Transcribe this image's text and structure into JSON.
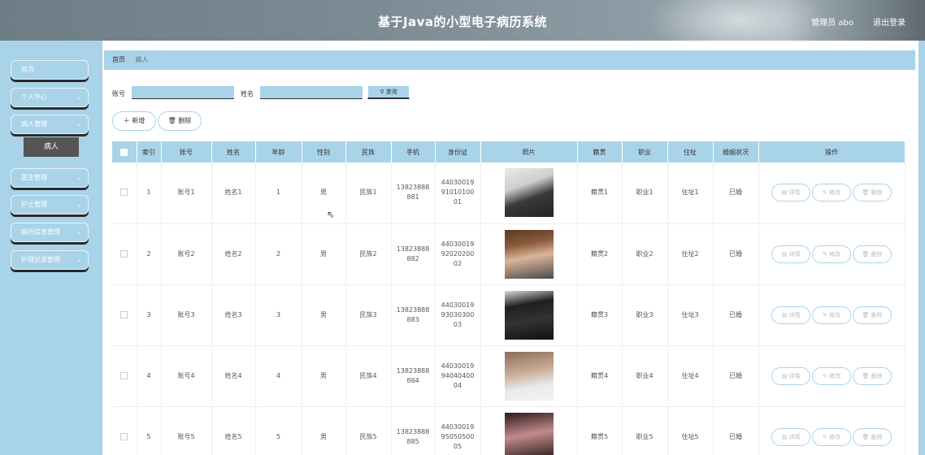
{
  "header": {
    "title": "基于Java的小型电子病历系统",
    "user": "管理员 abo",
    "logout": "退出登录"
  },
  "sidebar": {
    "items": [
      {
        "label": "首页",
        "has_chevron": false
      },
      {
        "label": "个人中心",
        "has_chevron": true
      },
      {
        "label": "病人管理",
        "has_chevron": true
      },
      {
        "label": "医生管理",
        "has_chevron": true
      },
      {
        "label": "护士管理",
        "has_chevron": true
      },
      {
        "label": "病历信息管理",
        "has_chevron": true
      },
      {
        "label": "护理记录管理",
        "has_chevron": true
      }
    ],
    "sub_item": "病人"
  },
  "breadcrumb": {
    "home": "首页",
    "current": "病人"
  },
  "search": {
    "account_label": "账号",
    "name_label": "姓名",
    "query_label": "查询"
  },
  "actions": {
    "add_label": "新增",
    "delete_label": "删除"
  },
  "table": {
    "headers": [
      "索引",
      "账号",
      "姓名",
      "年龄",
      "性别",
      "民族",
      "手机",
      "身份证",
      "照片",
      "籍贯",
      "职业",
      "住址",
      "婚姻状况",
      "操作"
    ],
    "op_labels": {
      "detail": "详情",
      "edit": "修改",
      "delete": "删除"
    },
    "rows": [
      {
        "index": "1",
        "account": "账号1",
        "name": "姓名1",
        "age": "1",
        "gender": "男",
        "ethnicity": "民族1",
        "phone": "13823888881",
        "id_card": "440300199101010001",
        "native": "籍贯1",
        "job": "职业1",
        "address": "住址1",
        "marital": "已婚"
      },
      {
        "index": "2",
        "account": "账号2",
        "name": "姓名2",
        "age": "2",
        "gender": "男",
        "ethnicity": "民族2",
        "phone": "13823888882",
        "id_card": "440300199202020002",
        "native": "籍贯2",
        "job": "职业2",
        "address": "住址2",
        "marital": "已婚"
      },
      {
        "index": "3",
        "account": "账号3",
        "name": "姓名3",
        "age": "3",
        "gender": "男",
        "ethnicity": "民族3",
        "phone": "13823888883",
        "id_card": "440300199303030003",
        "native": "籍贯3",
        "job": "职业3",
        "address": "住址3",
        "marital": "已婚"
      },
      {
        "index": "4",
        "account": "账号4",
        "name": "姓名4",
        "age": "4",
        "gender": "男",
        "ethnicity": "民族4",
        "phone": "13823888884",
        "id_card": "440300199404040004",
        "native": "籍贯4",
        "job": "职业4",
        "address": "住址4",
        "marital": "已婚"
      },
      {
        "index": "5",
        "account": "账号5",
        "name": "姓名5",
        "age": "5",
        "gender": "男",
        "ethnicity": "民族5",
        "phone": "13823888885",
        "id_card": "440300199505050005",
        "native": "籍贯5",
        "job": "职业5",
        "address": "住址5",
        "marital": "已婚"
      }
    ]
  },
  "colors": {
    "accent": "#a9d3e8",
    "sidebar_active": "#555555"
  }
}
